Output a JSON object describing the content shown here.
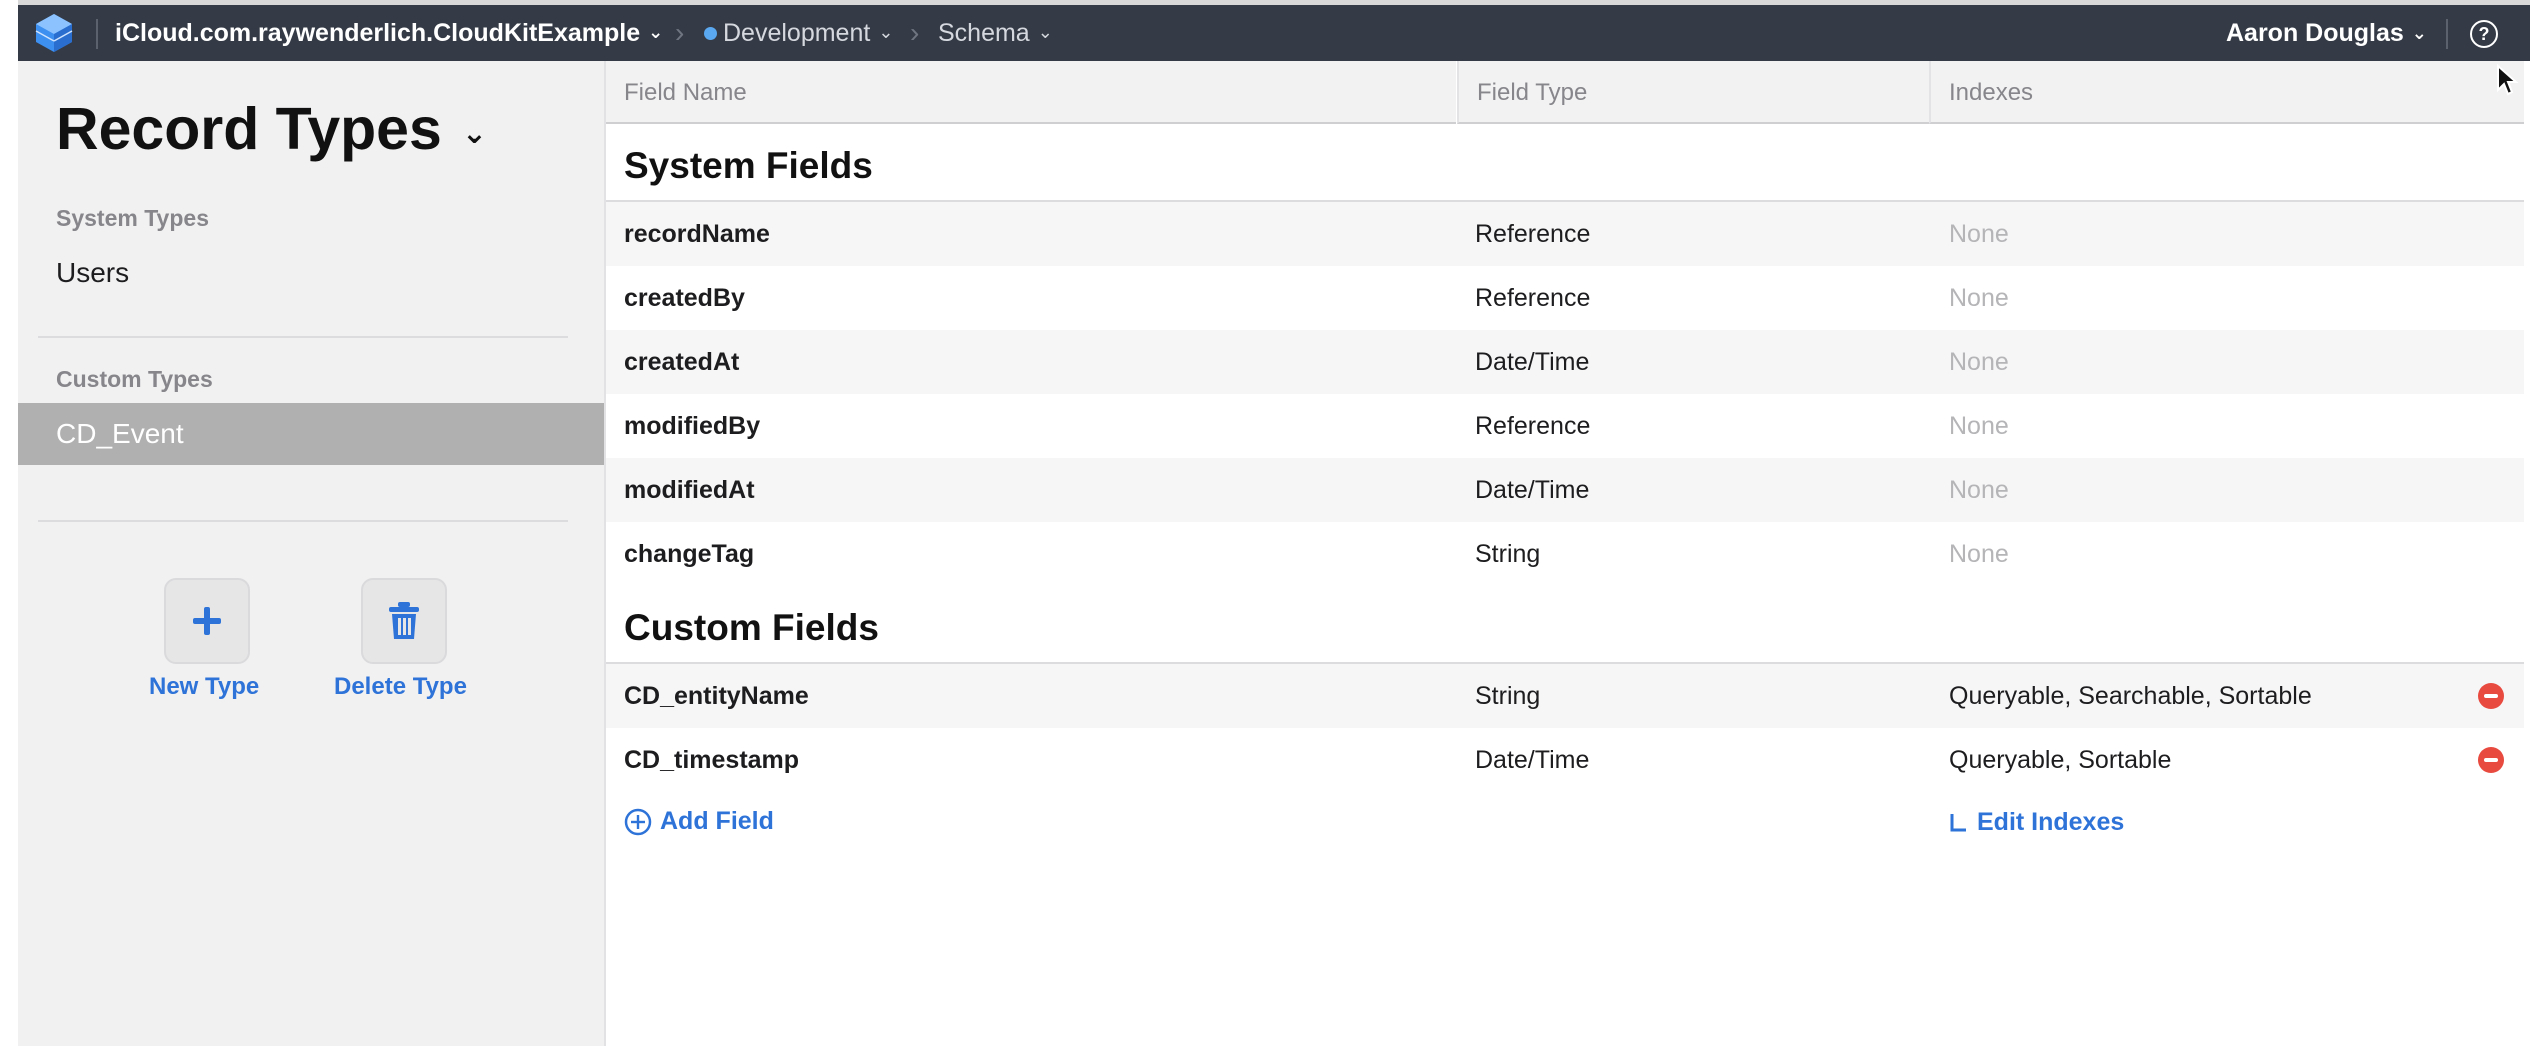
{
  "topbar": {
    "container": "iCloud.com.raywenderlich.CloudKitExample",
    "environment": "Development",
    "section": "Schema",
    "user": "Aaron Douglas",
    "help": "?"
  },
  "sidebar": {
    "title": "Record Types",
    "system_types_label": "System Types",
    "system_types": [
      "Users"
    ],
    "custom_types_label": "Custom Types",
    "custom_types": [
      "CD_Event"
    ],
    "new_type_label": "New Type",
    "delete_type_label": "Delete Type"
  },
  "table": {
    "headers": {
      "field_name": "Field Name",
      "field_type": "Field Type",
      "indexes": "Indexes"
    },
    "system_fields_title": "System Fields",
    "system_fields": [
      {
        "name": "recordName",
        "type": "Reference",
        "indexes": "None"
      },
      {
        "name": "createdBy",
        "type": "Reference",
        "indexes": "None"
      },
      {
        "name": "createdAt",
        "type": "Date/Time",
        "indexes": "None"
      },
      {
        "name": "modifiedBy",
        "type": "Reference",
        "indexes": "None"
      },
      {
        "name": "modifiedAt",
        "type": "Date/Time",
        "indexes": "None"
      },
      {
        "name": "changeTag",
        "type": "String",
        "indexes": "None"
      }
    ],
    "custom_fields_title": "Custom Fields",
    "custom_fields": [
      {
        "name": "CD_entityName",
        "type": "String",
        "indexes": "Queryable, Searchable, Sortable"
      },
      {
        "name": "CD_timestamp",
        "type": "Date/Time",
        "indexes": "Queryable, Sortable"
      }
    ],
    "add_field_label": "Add Field",
    "edit_indexes_label": "Edit Indexes"
  },
  "colors": {
    "topbar_bg": "#353b46",
    "accent": "#2e73d8",
    "remove": "#e84a3f",
    "selected_row": "#b0b0b0"
  }
}
